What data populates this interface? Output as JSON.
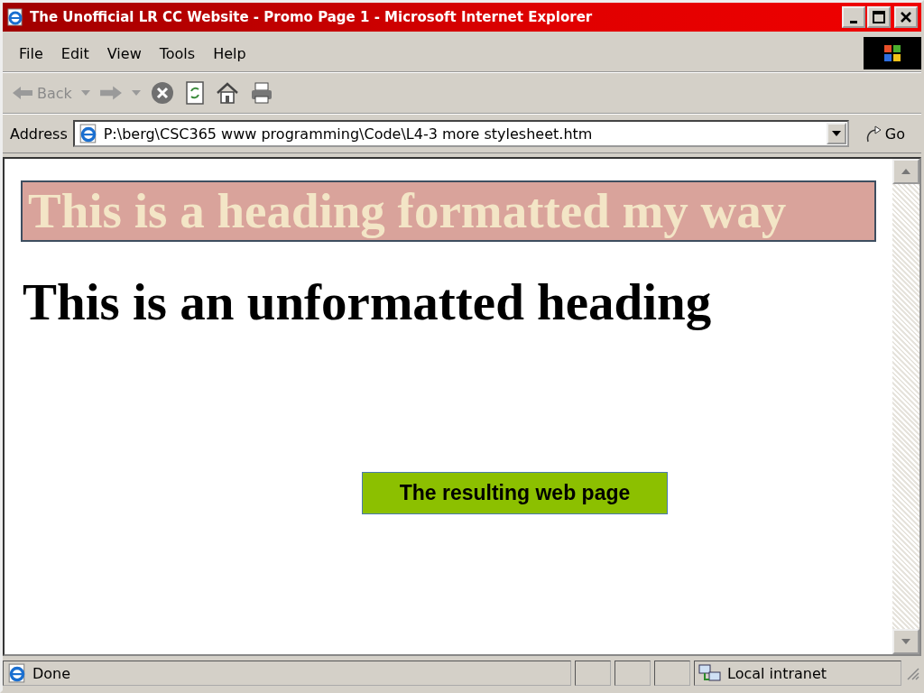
{
  "window": {
    "title": "The Unofficial LR CC Website - Promo Page 1 - Microsoft Internet Explorer"
  },
  "menu": [
    "File",
    "Edit",
    "View",
    "Tools",
    "Help"
  ],
  "toolbar": {
    "back_label": "Back"
  },
  "address_bar": {
    "label": "Address",
    "url": "P:\\berg\\CSC365 www programming\\Code\\L4-3 more stylesheet.htm",
    "go_label": "Go"
  },
  "page": {
    "headings": [
      {
        "kind": "styled",
        "text": "This is a heading formatted my way"
      },
      {
        "kind": "plain",
        "text": "This is an unformatted heading"
      }
    ]
  },
  "callout": {
    "text": "The resulting web page"
  },
  "status_bar": {
    "text": "Done",
    "zone": "Local intranet"
  }
}
